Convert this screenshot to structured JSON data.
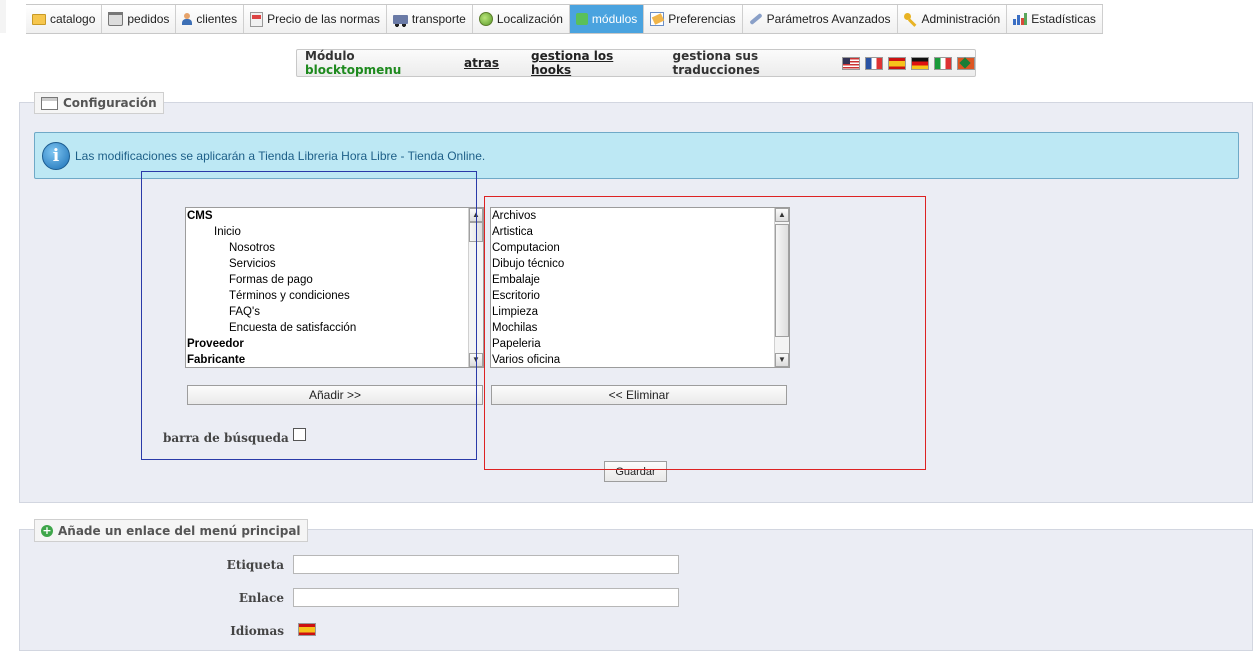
{
  "nav": {
    "tabs": [
      {
        "label": "catalogo",
        "icon": "folder-icon"
      },
      {
        "label": "pedidos",
        "icon": "cart-icon"
      },
      {
        "label": "clientes",
        "icon": "user-icon"
      },
      {
        "label": "Precio de las normas",
        "icon": "price-rules-icon"
      },
      {
        "label": "transporte",
        "icon": "truck-icon"
      },
      {
        "label": "Localización",
        "icon": "globe-icon"
      },
      {
        "label": "módulos",
        "icon": "puzzle-icon"
      },
      {
        "label": "Preferencias",
        "icon": "preferences-icon"
      },
      {
        "label": "Parámetros Avanzados",
        "icon": "wrench-icon"
      },
      {
        "label": "Administración",
        "icon": "key-icon"
      },
      {
        "label": "Estadísticas",
        "icon": "stats-icon"
      }
    ],
    "active_tab": "módulos",
    "active_color": "#4aa3df"
  },
  "module_bar": {
    "prefix": "Módulo",
    "module_name": "blocktopmenu",
    "back_label": "atras",
    "hooks_label": "gestiona los hooks",
    "translations_label": "gestiona sus traducciones",
    "flags": [
      "en",
      "fr",
      "es",
      "de",
      "it",
      "other"
    ]
  },
  "config": {
    "legend": "Configuración",
    "info_message": "Las modificaciones se aplicarán a Tienda Libreria Hora Libre - Tienda Online.",
    "available_items": [
      {
        "label": "CMS",
        "level": 0,
        "bold": true
      },
      {
        "label": "Inicio",
        "level": 1,
        "bold": false
      },
      {
        "label": "Nosotros",
        "level": 2,
        "bold": false
      },
      {
        "label": "Servicios",
        "level": 2,
        "bold": false
      },
      {
        "label": "Formas de pago",
        "level": 2,
        "bold": false
      },
      {
        "label": "Términos y condiciones",
        "level": 2,
        "bold": false
      },
      {
        "label": "FAQ's",
        "level": 2,
        "bold": false
      },
      {
        "label": "Encuesta de satisfacción",
        "level": 2,
        "bold": false
      },
      {
        "label": "Proveedor",
        "level": 0,
        "bold": true
      },
      {
        "label": "Fabricante",
        "level": 0,
        "bold": true
      }
    ],
    "selected_items": [
      "Archivos",
      "Artistica",
      "Computacion",
      "Dibujo técnico",
      "Embalaje",
      "Escritorio",
      "Limpieza",
      "Mochilas",
      "Papeleria",
      "Varios oficina"
    ],
    "add_button": "Añadir >>",
    "remove_button": "<< Eliminar",
    "search_bar_label": "barra de búsqueda",
    "search_bar_checked": false,
    "save_button": "Guardar"
  },
  "add_link": {
    "legend": "Añade un enlace del menú principal",
    "label_field": "Etiqueta",
    "link_field": "Enlace",
    "languages_field": "Idiomas"
  }
}
